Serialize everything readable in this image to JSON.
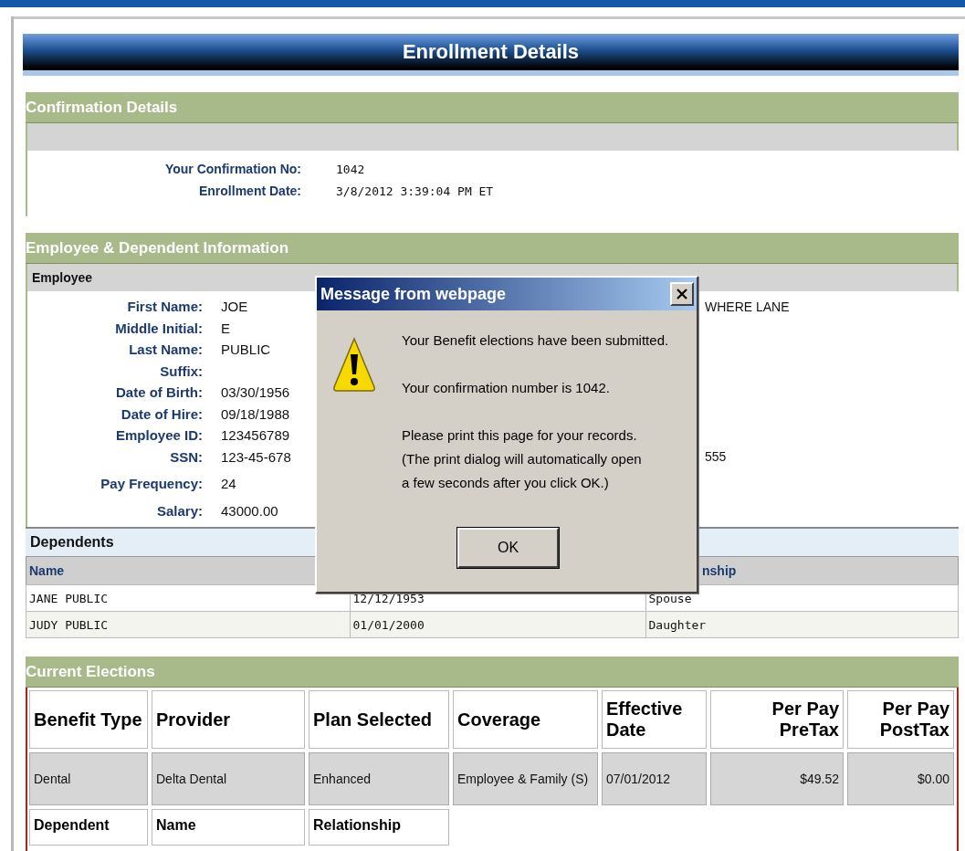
{
  "page_title": "Enrollment Details",
  "confirmation": {
    "title": "Confirmation Details",
    "fields": [
      {
        "label": "Your Confirmation No:",
        "value": "1042"
      },
      {
        "label": "Enrollment Date:",
        "value": "3/8/2012 3:39:04 PM ET"
      }
    ]
  },
  "employee_info": {
    "title": "Employee & Dependent Information",
    "employee": {
      "heading": "Employee",
      "fields": [
        {
          "label": "First Name:",
          "value": "JOE",
          "column_3": "WHERE LANE"
        },
        {
          "label": "Middle Initial:",
          "value": "E"
        },
        {
          "label": "Last Name:",
          "value": "PUBLIC"
        },
        {
          "label": "Suffix:"
        },
        {
          "label": "Date of Birth:",
          "value": "03/30/1956"
        },
        {
          "label": "Date of Hire:",
          "value": "09/18/1988"
        },
        {
          "label": "Employee ID:",
          "value": "123456789"
        },
        {
          "label": "SSN:",
          "value": "123-45-678",
          "column_3": "555"
        },
        {
          "label": "Pay Frequency:",
          "value": "24"
        },
        {
          "label": "Salary:",
          "value": "43000.00"
        }
      ]
    },
    "dependents": {
      "heading": "Dependents",
      "column_1": "Name",
      "column_3": "nship",
      "rows": [
        [
          "JANE PUBLIC",
          "12/12/1953",
          "Spouse"
        ],
        [
          "JUDY PUBLIC",
          "01/01/2000",
          "Daughter"
        ]
      ]
    }
  },
  "current_elections": {
    "title": "Current Elections",
    "columns": [
      "Benefit Type",
      "Provider",
      "Plan Selected",
      "Coverage",
      "Effective Date",
      "Per Pay PreTax",
      "Per Pay PostTax"
    ],
    "rows": [
      [
        "Dental",
        "Delta Dental",
        "Enhanced",
        "Employee & Family (S)",
        "07/01/2012",
        "$49.52",
        "$0.00"
      ]
    ],
    "dependent_columns": [
      "Dependent",
      "Name",
      "Relationship"
    ]
  },
  "dialog": {
    "title": "Message from webpage",
    "paragraphs": [
      [
        "Your Benefit elections have been submitted."
      ],
      [
        "Your confirmation number is 1042."
      ],
      [
        "Please print this page for your records.",
        "(The print dialog will automatically open",
        "a few seconds after you click OK.)"
      ]
    ],
    "button": "OK"
  }
}
